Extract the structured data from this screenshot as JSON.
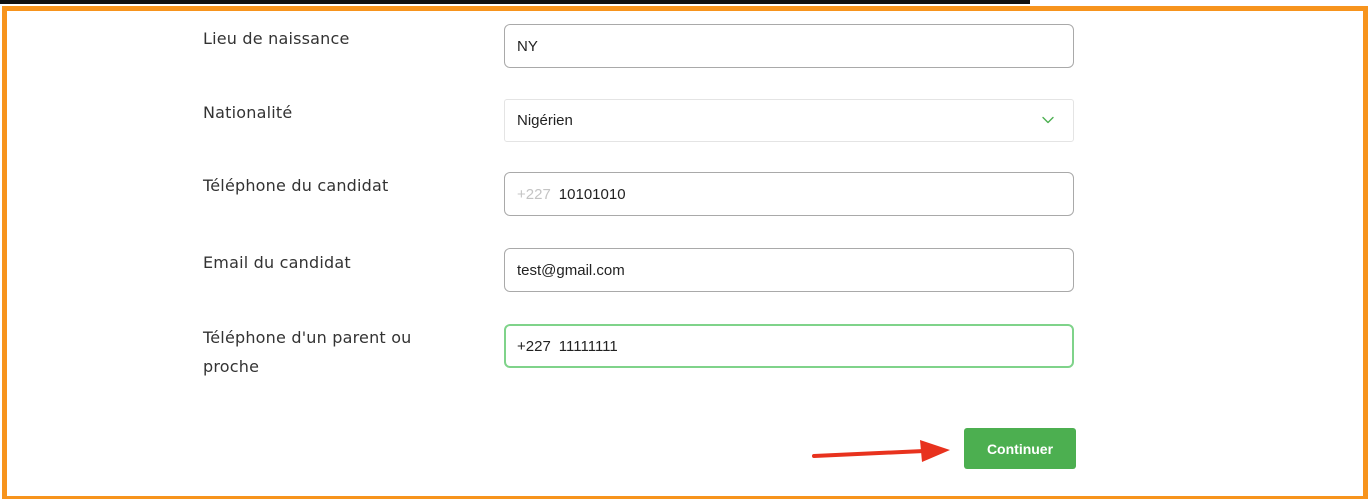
{
  "form": {
    "fields": [
      {
        "label": "Lieu de naissance",
        "value": "NY"
      },
      {
        "label": "Nationalité",
        "value": "Nigérien"
      },
      {
        "label": "Téléphone du candidat",
        "prefix": "+227",
        "value": "10101010"
      },
      {
        "label": "Email du candidat",
        "value": "test@gmail.com"
      },
      {
        "label_line1": "Téléphone d'un parent ou",
        "label_line2": "proche",
        "prefix": "+227",
        "value": "11111111"
      }
    ],
    "submit_label": "Continuer"
  },
  "colors": {
    "frame": "#f7941d",
    "button": "#4caf50",
    "focus_border": "#7fd38a",
    "arrow": "#e8321e",
    "chevron": "#4caf50"
  },
  "icons": {
    "dropdown": "chevron-down-icon",
    "annotation": "red-arrow-icon"
  }
}
